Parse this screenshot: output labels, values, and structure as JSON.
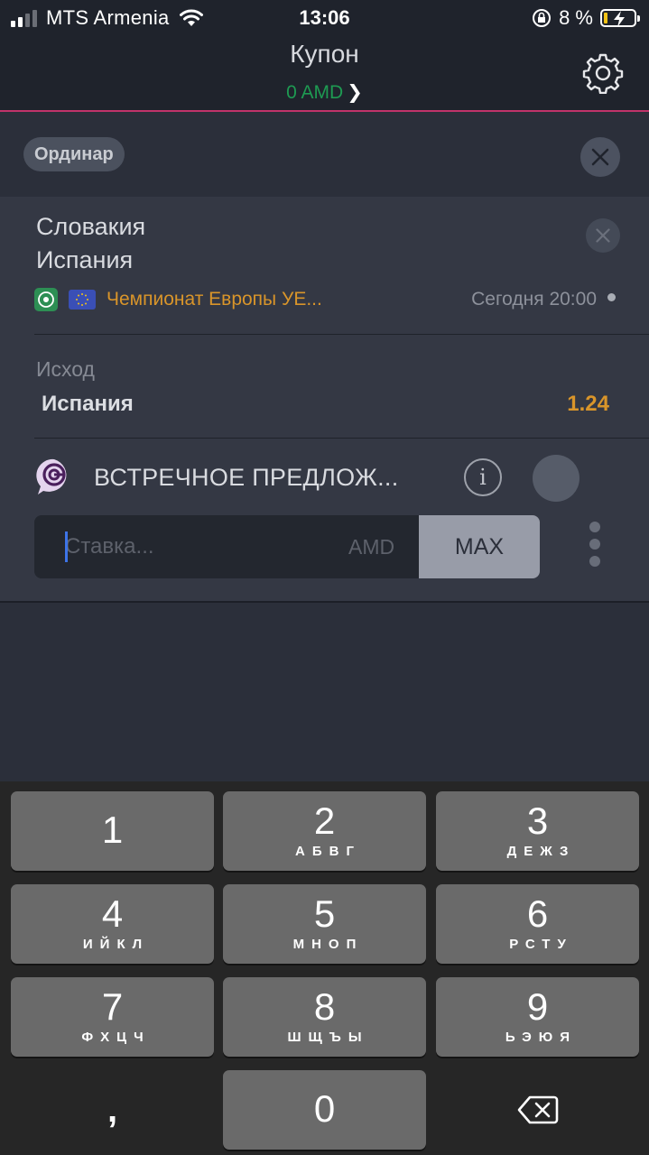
{
  "status_bar": {
    "carrier": "MTS Armenia",
    "time": "13:06",
    "battery_percent": "8 %",
    "battery_level": 0.08
  },
  "header": {
    "title": "Купон",
    "balance": "0 AMD",
    "balance_color": "#1e9a52",
    "accent_color": "#c1336a"
  },
  "coupon": {
    "type_label": "Ординар"
  },
  "bet": {
    "team1": "Словакия",
    "team2": "Испания",
    "league": "Чемпионат Европы УЕ...",
    "match_time": "Сегодня 20:00",
    "outcome_label": "Исход",
    "outcome_value": "Испания",
    "odds": "1.24",
    "counter_offer_label": "ВСТРЕЧНОЕ ПРЕДЛОЖ...",
    "stake_placeholder": "Ставка...",
    "stake_value": "",
    "currency": "AMD",
    "max_label": "MAX",
    "odds_color": "#d9952a"
  },
  "keyboard": {
    "keys": [
      {
        "num": "1",
        "letters": ""
      },
      {
        "num": "2",
        "letters": "АБВГ"
      },
      {
        "num": "3",
        "letters": "ДЕЖЗ"
      },
      {
        "num": "4",
        "letters": "ИЙКЛ"
      },
      {
        "num": "5",
        "letters": "МНОП"
      },
      {
        "num": "6",
        "letters": "РСТУ"
      },
      {
        "num": "7",
        "letters": "ФХЦЧ"
      },
      {
        "num": "8",
        "letters": "ШЩЪЫ"
      },
      {
        "num": "9",
        "letters": "ЬЭЮЯ"
      },
      {
        "num": "0",
        "letters": ""
      }
    ],
    "comma": ",",
    "delete_icon": "backspace-icon"
  }
}
